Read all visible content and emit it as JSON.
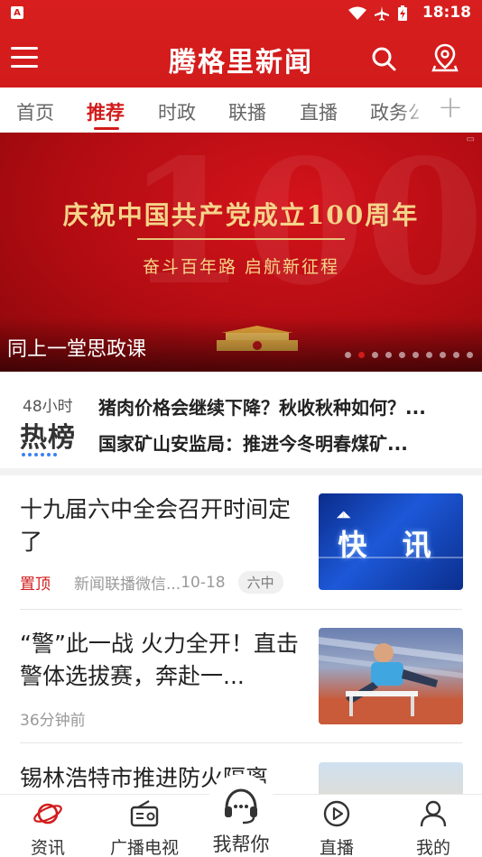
{
  "status_bar": {
    "time": "18:18",
    "sim_label": "A"
  },
  "app_bar": {
    "title": "腾格里新闻"
  },
  "tabs": [
    {
      "label": "首页",
      "active": false
    },
    {
      "label": "推荐",
      "active": true
    },
    {
      "label": "时政",
      "active": false
    },
    {
      "label": "联播",
      "active": false
    },
    {
      "label": "直播",
      "active": false
    },
    {
      "label": "政务公",
      "active": false
    }
  ],
  "banner": {
    "headline": "庆祝中国共产党成立100周年",
    "subline": "奋斗百年路 启航新征程",
    "caption": "同上一堂思政课",
    "page_count": 10,
    "active_index": 1
  },
  "hot_list": {
    "period_label": "48小时",
    "title": "热榜",
    "items": [
      "猪肉价格会继续下降？秋收秋种如何？...",
      "国家矿山安监局：推进今冬明春煤矿..."
    ]
  },
  "news": [
    {
      "title": "十九届六中全会召开时间定了",
      "pinned_label": "置顶",
      "source": "新闻联播微信...",
      "date": "10-18",
      "tag": "六中",
      "thumb_text": "快 讯"
    },
    {
      "title": "“警”此一战 火力全开！直击警体选拔赛，奔赴一...",
      "time": "36分钟前"
    },
    {
      "title": "锡林浩特市推进防火隔离"
    }
  ],
  "bottom_nav": [
    {
      "label": "资讯",
      "icon": "planet-icon"
    },
    {
      "label": "广播电视",
      "icon": "radio-icon"
    },
    {
      "label": "我帮你",
      "icon": "headset-icon"
    },
    {
      "label": "直播",
      "icon": "play-icon"
    },
    {
      "label": "我的",
      "icon": "user-icon"
    }
  ],
  "colors": {
    "brand_red": "#d21b1b",
    "banner_gold": "#f5d48a"
  }
}
